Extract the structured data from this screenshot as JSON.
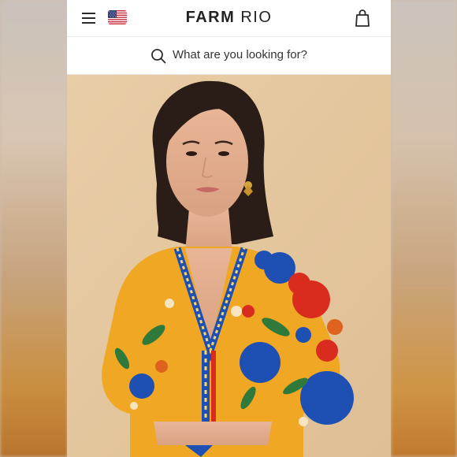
{
  "header": {
    "brand_primary": "FARM",
    "brand_secondary": "RIO",
    "menu_icon": "hamburger-menu-icon",
    "flag_icon": "us-flag-icon",
    "bag_icon": "shopping-bag-icon"
  },
  "search": {
    "placeholder": "What are you looking for?",
    "icon": "search-icon"
  },
  "hero": {
    "image": "model-wearing-floral-crop-top-photo",
    "colors": {
      "background": "#e7cba5",
      "top_yellow": "#f0a824",
      "flower_blue": "#1e4fb3",
      "flower_red": "#d92c1e",
      "leaf_green": "#2f7a3a"
    }
  }
}
